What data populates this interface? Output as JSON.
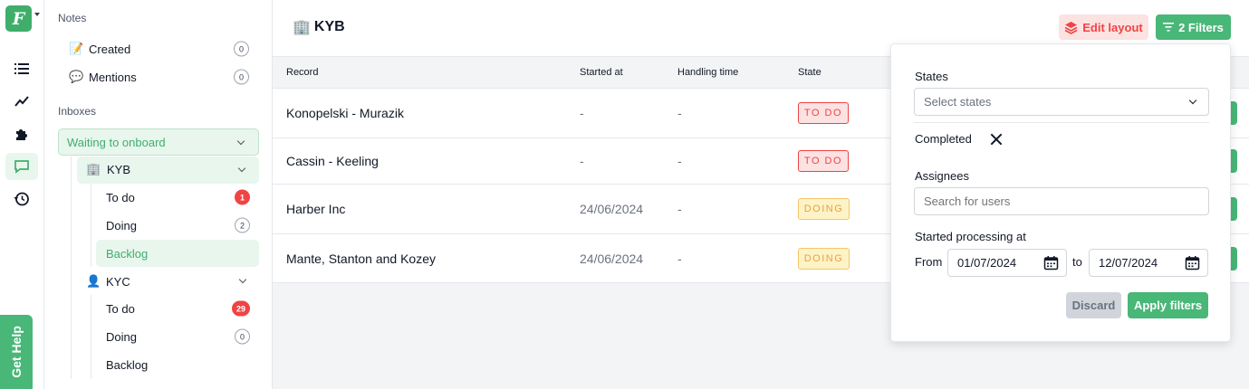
{
  "app": {
    "logo_letter": "F"
  },
  "rail": {
    "items": [
      {
        "icon": "list-icon"
      },
      {
        "icon": "trend-icon"
      },
      {
        "icon": "puzzle-icon"
      },
      {
        "icon": "chat-icon"
      },
      {
        "icon": "history-icon"
      }
    ],
    "get_help": "Get Help"
  },
  "sidebar": {
    "notes_title": "Notes",
    "notes": [
      {
        "emoji": "📝",
        "label": "Created",
        "count": "0"
      },
      {
        "emoji": "💬",
        "label": "Mentions",
        "count": "0"
      }
    ],
    "inboxes_title": "Inboxes",
    "inbox": "Waiting to onboard",
    "groups": [
      {
        "emoji": "🏢",
        "label": "KYB",
        "items": [
          {
            "label": "To do",
            "count": "1",
            "count_style": "red"
          },
          {
            "label": "Doing",
            "count": "2",
            "count_style": "plain"
          },
          {
            "label": "Backlog",
            "count": "",
            "active": true
          }
        ]
      },
      {
        "emoji": "👤",
        "label": "KYC",
        "items": [
          {
            "label": "To do",
            "count": "29",
            "count_style": "red"
          },
          {
            "label": "Doing",
            "count": "0",
            "count_style": "plain"
          },
          {
            "label": "Backlog",
            "count": ""
          }
        ]
      }
    ]
  },
  "header": {
    "emoji": "🏢",
    "title": "KYB",
    "edit_layout": "Edit layout",
    "filters": "2 Filters"
  },
  "table": {
    "columns": [
      "Record",
      "Started at",
      "Handling time",
      "State"
    ],
    "rows": [
      {
        "record": "Konopelski - Murazik",
        "started": "-",
        "handling": "-",
        "state": "TO DO",
        "state_type": "todo"
      },
      {
        "record": "Cassin - Keeling",
        "started": "-",
        "handling": "-",
        "state": "TO DO",
        "state_type": "todo"
      },
      {
        "record": "Harber Inc",
        "started": "24/06/2024",
        "handling": "-",
        "state": "DOING",
        "state_type": "doing"
      },
      {
        "record": "Mante, Stanton and Kozey",
        "started": "24/06/2024",
        "handling": "-",
        "state": "DOING",
        "state_type": "doing"
      }
    ]
  },
  "filters_panel": {
    "states_label": "States",
    "states_placeholder": "Select states",
    "completed_label": "Completed",
    "assignees_label": "Assignees",
    "assignees_placeholder": "Search for users",
    "started_label": "Started processing at",
    "from_label": "From",
    "from_value": "01/07/2024",
    "to_label": "to",
    "to_value": "12/07/2024",
    "discard": "Discard",
    "apply": "Apply filters"
  },
  "colors": {
    "accent": "#48b777",
    "danger": "#ef4444",
    "warning": "#e6a23c"
  }
}
